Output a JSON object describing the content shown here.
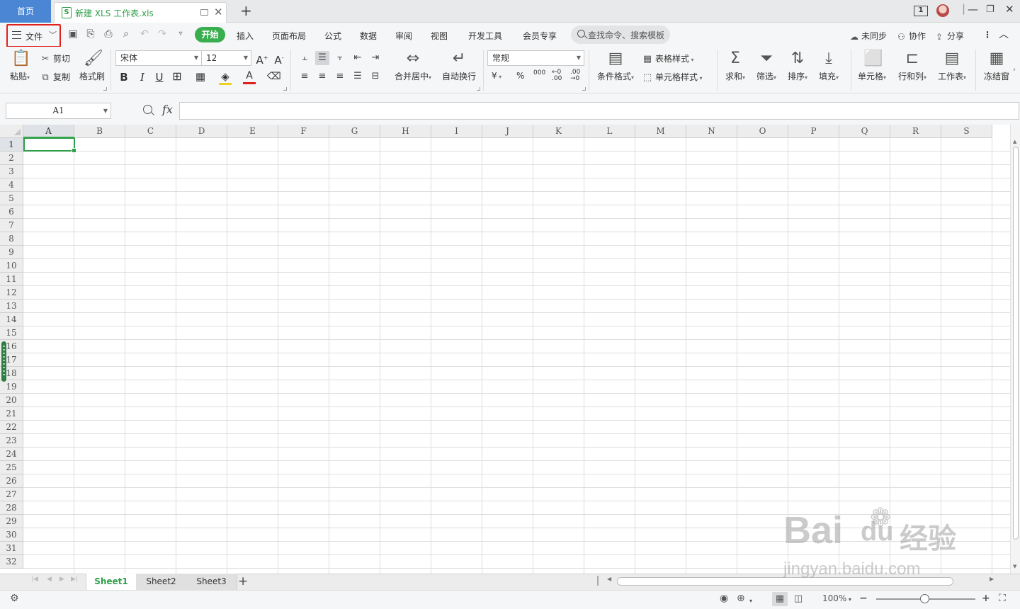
{
  "tabbar": {
    "home_label": "首页",
    "doc_title": "新建 XLS 工作表.xls",
    "doc_icon_letter": "S",
    "window_badge": "1"
  },
  "menubar": {
    "file_label": "文件",
    "items": [
      "开始",
      "插入",
      "页面布局",
      "公式",
      "数据",
      "审阅",
      "视图",
      "开发工具",
      "会员专享"
    ],
    "search_placeholder": "查找命令、搜索模板",
    "sync_label": "未同步",
    "collab_label": "协作",
    "share_label": "分享"
  },
  "ribbon": {
    "paste": "粘贴",
    "cut": "剪切",
    "copy": "复制",
    "format_painter": "格式刷",
    "font_name": "宋体",
    "font_size": "12",
    "merge_center": "合并居中",
    "wrap_text": "自动换行",
    "number_format": "常规",
    "conditional_format": "条件格式",
    "table_style": "表格样式",
    "cell_style": "单元格样式",
    "sum": "求和",
    "filter": "筛选",
    "sort": "排序",
    "fill": "填充",
    "cell": "单元格",
    "row_col": "行和列",
    "worksheet": "工作表",
    "freeze": "冻结窗",
    "currency_symbol": "¥",
    "percent_symbol": "%",
    "thousands_symbol": "000",
    "accent_color": "#3aae4f"
  },
  "formula": {
    "name_box": "A1",
    "fx_label": "fx",
    "value": ""
  },
  "grid": {
    "columns": [
      "A",
      "B",
      "C",
      "D",
      "E",
      "F",
      "G",
      "H",
      "I",
      "J",
      "K",
      "L",
      "M",
      "N",
      "O",
      "P",
      "Q",
      "R",
      "S"
    ],
    "rows": [
      "1",
      "2",
      "3",
      "4",
      "5",
      "6",
      "7",
      "8",
      "9",
      "10",
      "11",
      "12",
      "13",
      "14",
      "15",
      "16",
      "17",
      "18",
      "19",
      "20",
      "21",
      "22",
      "23",
      "24",
      "25",
      "26",
      "27",
      "28",
      "29",
      "30",
      "31",
      "32"
    ],
    "active_cell": "A1"
  },
  "sheets": {
    "tabs": [
      "Sheet1",
      "Sheet2",
      "Sheet3"
    ],
    "active": "Sheet1"
  },
  "status": {
    "zoom": "100%"
  },
  "watermark": {
    "brand": "Bai",
    "brand2": "du",
    "brand_cn": "经验",
    "url": "jingyan.baidu.com"
  }
}
